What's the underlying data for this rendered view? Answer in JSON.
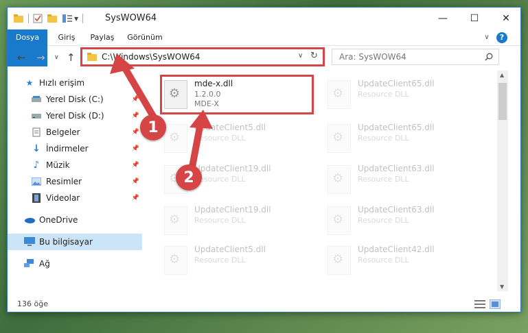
{
  "window": {
    "title": "SysWOW64",
    "minimize_glyph": "—",
    "maximize_glyph": "☐",
    "close_glyph": "✕",
    "help_glyph": "?",
    "collapse_glyph": "∨"
  },
  "ribbon": {
    "tabs": [
      "Dosya",
      "Giriş",
      "Paylaş",
      "Görünüm"
    ]
  },
  "nav": {
    "back": "←",
    "forward": "→",
    "recent": "∨",
    "up": "↑",
    "address": "C:\\Windows\\SysWOW64",
    "search_placeholder": "Ara: SysWOW64",
    "refresh": "↻",
    "dropdown": "∨"
  },
  "sidebar": {
    "items": [
      {
        "label": "Hızlı erişim",
        "icon": "star-icon"
      },
      {
        "label": "Yerel Disk (C:)",
        "icon": "drive-icon"
      },
      {
        "label": "Yerel Disk (D:)",
        "icon": "drive-icon"
      },
      {
        "label": "Belgeler",
        "icon": "documents-icon"
      },
      {
        "label": "İndirmeler",
        "icon": "download-icon"
      },
      {
        "label": "Müzik",
        "icon": "music-icon"
      },
      {
        "label": "Resimler",
        "icon": "pictures-icon"
      },
      {
        "label": "Videolar",
        "icon": "videos-icon"
      },
      {
        "label": "OneDrive",
        "icon": "cloud-icon"
      },
      {
        "label": "Bu bilgisayar",
        "icon": "computer-icon"
      },
      {
        "label": "Ağ",
        "icon": "network-icon"
      }
    ]
  },
  "files": [
    {
      "name": "mde-x.dll",
      "line2": "1.2.0.0",
      "line3": "MDE-X"
    },
    {
      "name": "UpdateClient65.dll",
      "line2": "Resource DLL"
    },
    {
      "name": "UpdateClient5.dll",
      "line2": "Resource DLL"
    },
    {
      "name": "UpdateClient65.dll",
      "line2": "Resource DLL"
    },
    {
      "name": "UpdateClient19.dll",
      "line2": "Resource DLL"
    },
    {
      "name": "UpdateClient63.dll",
      "line2": "Resource DLL"
    },
    {
      "name": "UpdateClient19.dll",
      "line2": "Resource DLL"
    },
    {
      "name": "UpdateClient63.dll",
      "line2": "Resource DLL"
    },
    {
      "name": "UpdateClient5.dll",
      "line2": "Resource DLL"
    },
    {
      "name": "UpdateClient42.dll",
      "line2": "Resource DLL"
    }
  ],
  "status": {
    "item_count": "136 öğe"
  },
  "annotations": {
    "step1": "1",
    "step2": "2",
    "color": "#d64545"
  }
}
